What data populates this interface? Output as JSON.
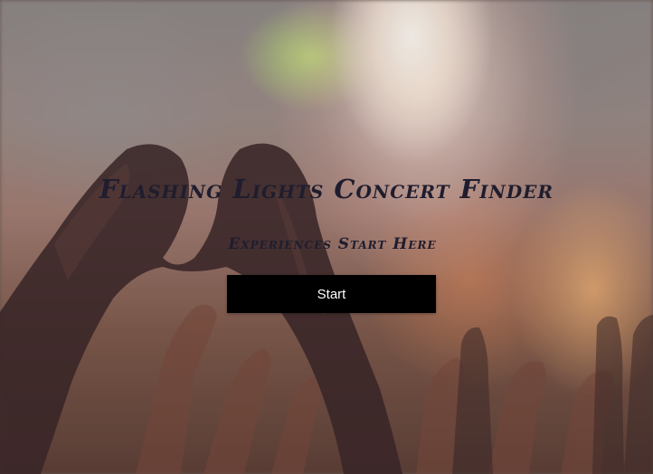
{
  "hero": {
    "title": "Flashing Lights Concert Finder",
    "subtitle": "Experiences Start Here",
    "start_label": "Start",
    "background_image": "concert-crowd-heart-hands"
  },
  "colors": {
    "heading_text": "#1f1d2e",
    "button_bg": "#000000",
    "button_text": "#ffffff"
  }
}
